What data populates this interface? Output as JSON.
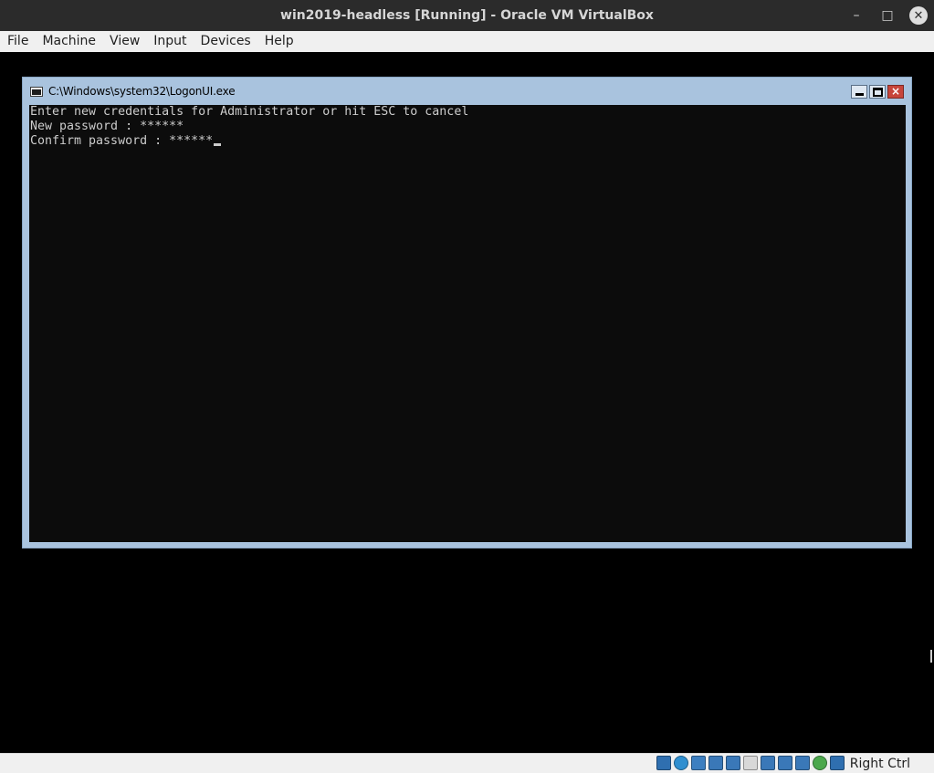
{
  "host_window": {
    "title": "win2019-headless [Running] - Oracle VM VirtualBox",
    "controls": {
      "minimize": "–",
      "maximize": "□",
      "close": "✕"
    }
  },
  "menubar": {
    "items": [
      {
        "label": "File"
      },
      {
        "label": "Machine"
      },
      {
        "label": "View"
      },
      {
        "label": "Input"
      },
      {
        "label": "Devices"
      },
      {
        "label": "Help"
      }
    ]
  },
  "console_window": {
    "title": "C:\\Windows\\system32\\LogonUI.exe",
    "close_glyph": "×",
    "lines": [
      "Enter new credentials for Administrator or hit ESC to cancel",
      "New password : ******",
      "Confirm password : ******"
    ]
  },
  "statusbar": {
    "host_key_label": "Right Ctrl",
    "icons": [
      {
        "name": "hard-disk-icon",
        "color": "#2f6fb0"
      },
      {
        "name": "optical-drive-icon",
        "color": "#2f8fd0"
      },
      {
        "name": "audio-icon",
        "color": "#3d7fc0"
      },
      {
        "name": "network-icon",
        "color": "#3a78b8"
      },
      {
        "name": "usb-icon",
        "color": "#3a78b8"
      },
      {
        "name": "shared-folders-icon",
        "color": "#d8d8d8"
      },
      {
        "name": "display-icon",
        "color": "#3a78b8"
      },
      {
        "name": "video-capture-icon",
        "color": "#3a78b8"
      },
      {
        "name": "virtualization-icon",
        "color": "#3a78b8"
      },
      {
        "name": "mouse-integration-icon",
        "color": "#4ca84c"
      },
      {
        "name": "keyboard-capture-icon",
        "color": "#2f6fb0"
      }
    ]
  }
}
